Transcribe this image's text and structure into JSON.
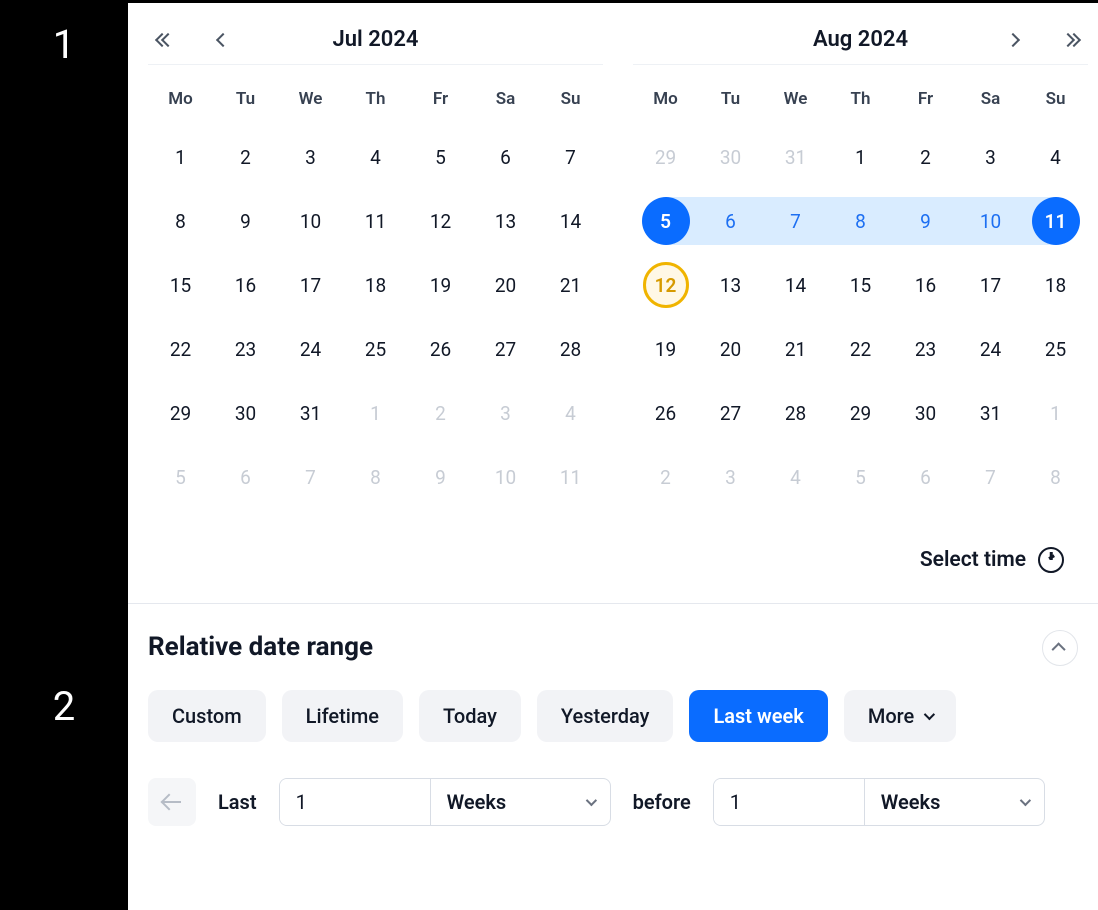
{
  "sidebar": {
    "step1": "1",
    "step2": "2"
  },
  "calendar": {
    "weekdays": [
      "Mo",
      "Tu",
      "We",
      "Th",
      "Fr",
      "Sa",
      "Su"
    ],
    "left": {
      "title": "Jul 2024",
      "weeks": [
        [
          {
            "d": "1"
          },
          {
            "d": "2"
          },
          {
            "d": "3"
          },
          {
            "d": "4"
          },
          {
            "d": "5"
          },
          {
            "d": "6"
          },
          {
            "d": "7"
          }
        ],
        [
          {
            "d": "8"
          },
          {
            "d": "9"
          },
          {
            "d": "10"
          },
          {
            "d": "11"
          },
          {
            "d": "12"
          },
          {
            "d": "13"
          },
          {
            "d": "14"
          }
        ],
        [
          {
            "d": "15"
          },
          {
            "d": "16"
          },
          {
            "d": "17"
          },
          {
            "d": "18"
          },
          {
            "d": "19"
          },
          {
            "d": "20"
          },
          {
            "d": "21"
          }
        ],
        [
          {
            "d": "22"
          },
          {
            "d": "23"
          },
          {
            "d": "24"
          },
          {
            "d": "25"
          },
          {
            "d": "26"
          },
          {
            "d": "27"
          },
          {
            "d": "28"
          }
        ],
        [
          {
            "d": "29"
          },
          {
            "d": "30"
          },
          {
            "d": "31"
          },
          {
            "d": "1",
            "o": true
          },
          {
            "d": "2",
            "o": true
          },
          {
            "d": "3",
            "o": true
          },
          {
            "d": "4",
            "o": true
          }
        ],
        [
          {
            "d": "5",
            "o": true
          },
          {
            "d": "6",
            "o": true
          },
          {
            "d": "7",
            "o": true
          },
          {
            "d": "8",
            "o": true
          },
          {
            "d": "9",
            "o": true
          },
          {
            "d": "10",
            "o": true
          },
          {
            "d": "11",
            "o": true
          }
        ]
      ]
    },
    "right": {
      "title": "Aug 2024",
      "weeks": [
        [
          {
            "d": "29",
            "o": true
          },
          {
            "d": "30",
            "o": true
          },
          {
            "d": "31",
            "o": true
          },
          {
            "d": "1"
          },
          {
            "d": "2"
          },
          {
            "d": "3"
          },
          {
            "d": "4"
          }
        ],
        [
          {
            "d": "5",
            "start": true
          },
          {
            "d": "6",
            "in": true
          },
          {
            "d": "7",
            "in": true
          },
          {
            "d": "8",
            "in": true
          },
          {
            "d": "9",
            "in": true
          },
          {
            "d": "10",
            "in": true
          },
          {
            "d": "11",
            "end": true
          }
        ],
        [
          {
            "d": "12",
            "today": true
          },
          {
            "d": "13"
          },
          {
            "d": "14"
          },
          {
            "d": "15"
          },
          {
            "d": "16"
          },
          {
            "d": "17"
          },
          {
            "d": "18"
          }
        ],
        [
          {
            "d": "19"
          },
          {
            "d": "20"
          },
          {
            "d": "21"
          },
          {
            "d": "22"
          },
          {
            "d": "23"
          },
          {
            "d": "24"
          },
          {
            "d": "25"
          }
        ],
        [
          {
            "d": "26"
          },
          {
            "d": "27"
          },
          {
            "d": "28"
          },
          {
            "d": "29"
          },
          {
            "d": "30"
          },
          {
            "d": "31"
          },
          {
            "d": "1",
            "o": true
          }
        ],
        [
          {
            "d": "2",
            "o": true
          },
          {
            "d": "3",
            "o": true
          },
          {
            "d": "4",
            "o": true
          },
          {
            "d": "5",
            "o": true
          },
          {
            "d": "6",
            "o": true
          },
          {
            "d": "7",
            "o": true
          },
          {
            "d": "8",
            "o": true
          }
        ]
      ]
    },
    "select_time": "Select time"
  },
  "relative": {
    "title": "Relative date range",
    "chips": {
      "custom": "Custom",
      "lifetime": "Lifetime",
      "today": "Today",
      "yesterday": "Yesterday",
      "last_week": "Last week",
      "more": "More"
    },
    "active_chip": "last_week",
    "row": {
      "last_label": "Last",
      "last_value": "1",
      "last_unit": "Weeks",
      "before_label": "before",
      "before_value": "1",
      "before_unit": "Weeks"
    }
  }
}
